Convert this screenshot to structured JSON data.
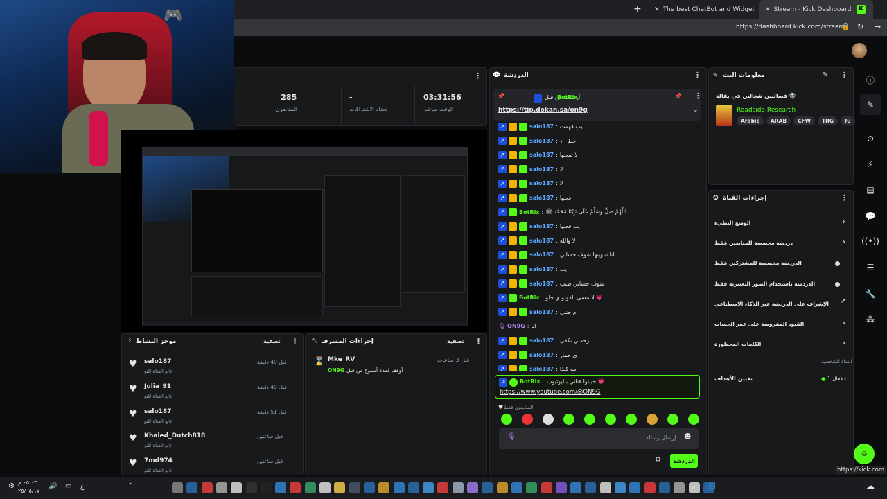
{
  "browser": {
    "tabs": [
      {
        "label": "The best ChatBot and Widgets for"
      },
      {
        "label": "Stream - Kick Dashboard"
      }
    ],
    "url": "https://dashboard.kick.com/stream"
  },
  "stats": {
    "viewers_value": "285",
    "viewers_label": "المتابعون",
    "subs_value": "-",
    "subs_label": "تعداد الاشتراكات",
    "time_value": "03:31:56",
    "time_label": "الوقت مباشر"
  },
  "chat": {
    "title": "الدردشة",
    "pinned": {
      "sent_by": "أرسلت من قبل",
      "user": "BotRix",
      "link": "https://tip.dokan.sa/on9g"
    },
    "messages": [
      {
        "user": "salo187",
        "text": "يب فهمت",
        "type": "blue"
      },
      {
        "user": "salo187",
        "text": "حط ١٠",
        "type": "blue"
      },
      {
        "user": "salo187",
        "text": "لا تفعلها",
        "type": "blue"
      },
      {
        "user": "salo187",
        "text": "لا",
        "type": "blue"
      },
      {
        "user": "salo187",
        "text": "لا",
        "type": "blue"
      },
      {
        "user": "salo187",
        "text": "فعلها",
        "type": "blue"
      },
      {
        "user": "BotRix",
        "text": "اللَّهُمَّ صَلِّ وَسَلِّمْ عَلَى نَبِيِّنَا مُحَمَّد ﷺ",
        "type": "green"
      },
      {
        "user": "salo187",
        "text": "يب فعلها",
        "type": "blue"
      },
      {
        "user": "salo187",
        "text": "لا والله",
        "type": "blue"
      },
      {
        "user": "salo187",
        "text": "انا سويتها شوف حسابي",
        "type": "blue"
      },
      {
        "user": "salo187",
        "text": "يب",
        "type": "blue"
      },
      {
        "user": "salo187",
        "text": "شوف حسابي طيب",
        "type": "blue"
      },
      {
        "user": "BotRix",
        "text": "لا تنسى الفولو ي حلو 💗",
        "type": "green"
      },
      {
        "user": "salo187",
        "text": "م جنني",
        "type": "blue"
      },
      {
        "user": "ON9G",
        "text": "انا",
        "type": "purple"
      },
      {
        "user": "salo187",
        "text": "ارحمني تكفى",
        "type": "blue"
      },
      {
        "user": "salo187",
        "text": "ي حمار",
        "type": "blue"
      },
      {
        "user": "salo187",
        "text": "مو كيذا",
        "type": "blue"
      }
    ],
    "highlight": {
      "user": "BotRix",
      "text": "حبيتوا قناتي باليوتيوب 💗",
      "link": "https://www.youtube.com/@ON9G"
    },
    "followers_only": "المتابعون فقط",
    "input_placeholder": "إرسال رسالة",
    "send_label": "الدردشة"
  },
  "stream_info": {
    "title": "معلومات البث",
    "stream_title": "فضائيين شغالين في بقالة 👽",
    "game": "Roadside Research",
    "tags": [
      "Arabic",
      "ARAB",
      "CFW",
      "TRG",
      "fu"
    ]
  },
  "channel_actions": {
    "title": "إجراءات القناة",
    "items": [
      {
        "label": "الوضع البطيء",
        "control": "arrow"
      },
      {
        "label": "دردشة مخصصة للمتابعين فقط",
        "control": "arrow"
      },
      {
        "label": "الدردشة مخصصة للمشتركين فقط",
        "control": "toggle"
      },
      {
        "label": "الدردشة باستخدام الصور التعبيرية فقط",
        "control": "toggle"
      },
      {
        "label": "الإشراف على الدردشة عبر الذكاء الاصطناعي",
        "control": "link"
      },
      {
        "label": "القيود المفروضة على عمر الحساب",
        "control": "arrow"
      },
      {
        "label": "الكلمات المحظورة",
        "control": "arrow"
      }
    ],
    "section_label": "القناة الشخصية",
    "goals_label": "تعيين الأهداف",
    "goals_status": "فعال 1"
  },
  "mod_actions": {
    "title": "إجراءات المشرف",
    "filter": "تصفية",
    "user": "Mke_RV",
    "time": "قبل 3 ساعات",
    "desc": "أوقف لمدة أسبوع من قبل",
    "target": "ON9G"
  },
  "activity": {
    "title": "موجز النشاط",
    "filter": "تصفية",
    "items": [
      {
        "user": "salo187",
        "sub": "تابع القناة للتو",
        "time": "قبل 49 دقيقة"
      },
      {
        "user": "Julia_91",
        "sub": "تابع القناة للتو",
        "time": "قبل 49 دقيقة"
      },
      {
        "user": "salo187",
        "sub": "تابع القناة للتو",
        "time": "قبل 51 دقيقة"
      },
      {
        "user": "Khaled_Dutch818",
        "sub": "تابع القناة للتو",
        "time": "قبل ساعتين"
      },
      {
        "user": "7md974",
        "sub": "تابع القناة للتو",
        "time": "قبل ساعتين"
      }
    ]
  },
  "status_url": "https://kick.com",
  "taskbar": {
    "time": "٠٥:٠٣ م",
    "date": "٢٥/٠٥/١٧",
    "lang": "ع"
  },
  "colors": {
    "accent": "#53fc18",
    "panel": "#18191b",
    "bg": "#0b0c0d"
  }
}
